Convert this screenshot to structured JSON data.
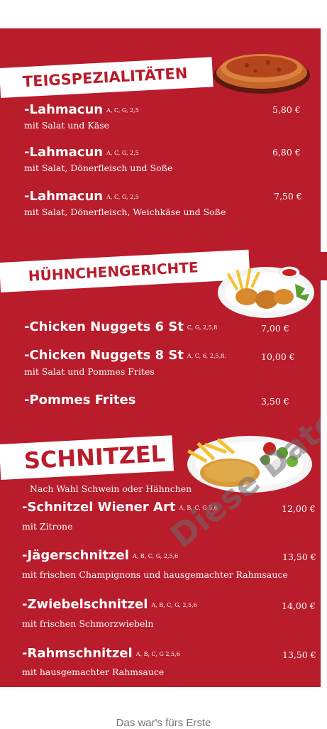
{
  "sections": [
    {
      "title": "TEIGSPEZIALITÄTEN",
      "items": [
        {
          "name": "-Lahmacun",
          "codes": "A, C, G, 2,5",
          "desc": "mit Salat und Käse",
          "price": "5,80 €"
        },
        {
          "name": "-Lahmacun",
          "codes": "A, C, G, 2,5",
          "desc": "mit Salat, Dönerfleisch und Soße",
          "price": "6,80 €"
        },
        {
          "name": "-Lahmacun",
          "codes": "A, C, G, 2,5",
          "desc": "mit Salat, Dönerfleisch, Weichkäse und Soße",
          "price": "7,50 €"
        }
      ]
    },
    {
      "title": "HÜHNCHENGERICHTE",
      "items": [
        {
          "name": "-Chicken Nuggets 6 St",
          "codes": "C, G, 2,5,8",
          "desc": "",
          "price": "7,00 €"
        },
        {
          "name": "-Chicken Nuggets 8 St",
          "codes": "A, C, 6, 2,5,8.",
          "desc": "mit Salat  und Pommes Frites",
          "price": "10,00 €"
        },
        {
          "name": "-Pommes Frites",
          "codes": "",
          "desc": "",
          "price": "3,50 €"
        }
      ]
    },
    {
      "title": "SCHNITZEL",
      "note": "Nach Wahl Schwein oder Hähnchen",
      "items": [
        {
          "name": "-Schnitzel Wiener Art",
          "codes": "A, B, C, G 5,6",
          "desc": "mit Zitrone",
          "price": "12,00 €"
        },
        {
          "name": "-Jägerschnitzel",
          "codes": "A, B, C, G,   2,5,6",
          "desc": "mit frischen Champignons und hausgemachter Rahmsauce",
          "price": "13,50 €"
        },
        {
          "name": "-Zwiebelschnitzel",
          "codes": "A, B, C, G, 2,5,6",
          "desc": "mit frischen Schmorzwiebeln",
          "price": "14,00 €"
        },
        {
          "name": "-Rahmschnitzel",
          "codes": "A, B, C, G 2,5,6",
          "desc": "mit hausgemachter Rahmsauce",
          "price": "13,50 €"
        }
      ]
    }
  ],
  "watermark": "Diese Datei",
  "footer": "Das war's fürs Erste",
  "colors": {
    "menu_red": "#b91c2b",
    "banner_bg": "#ffffff"
  }
}
